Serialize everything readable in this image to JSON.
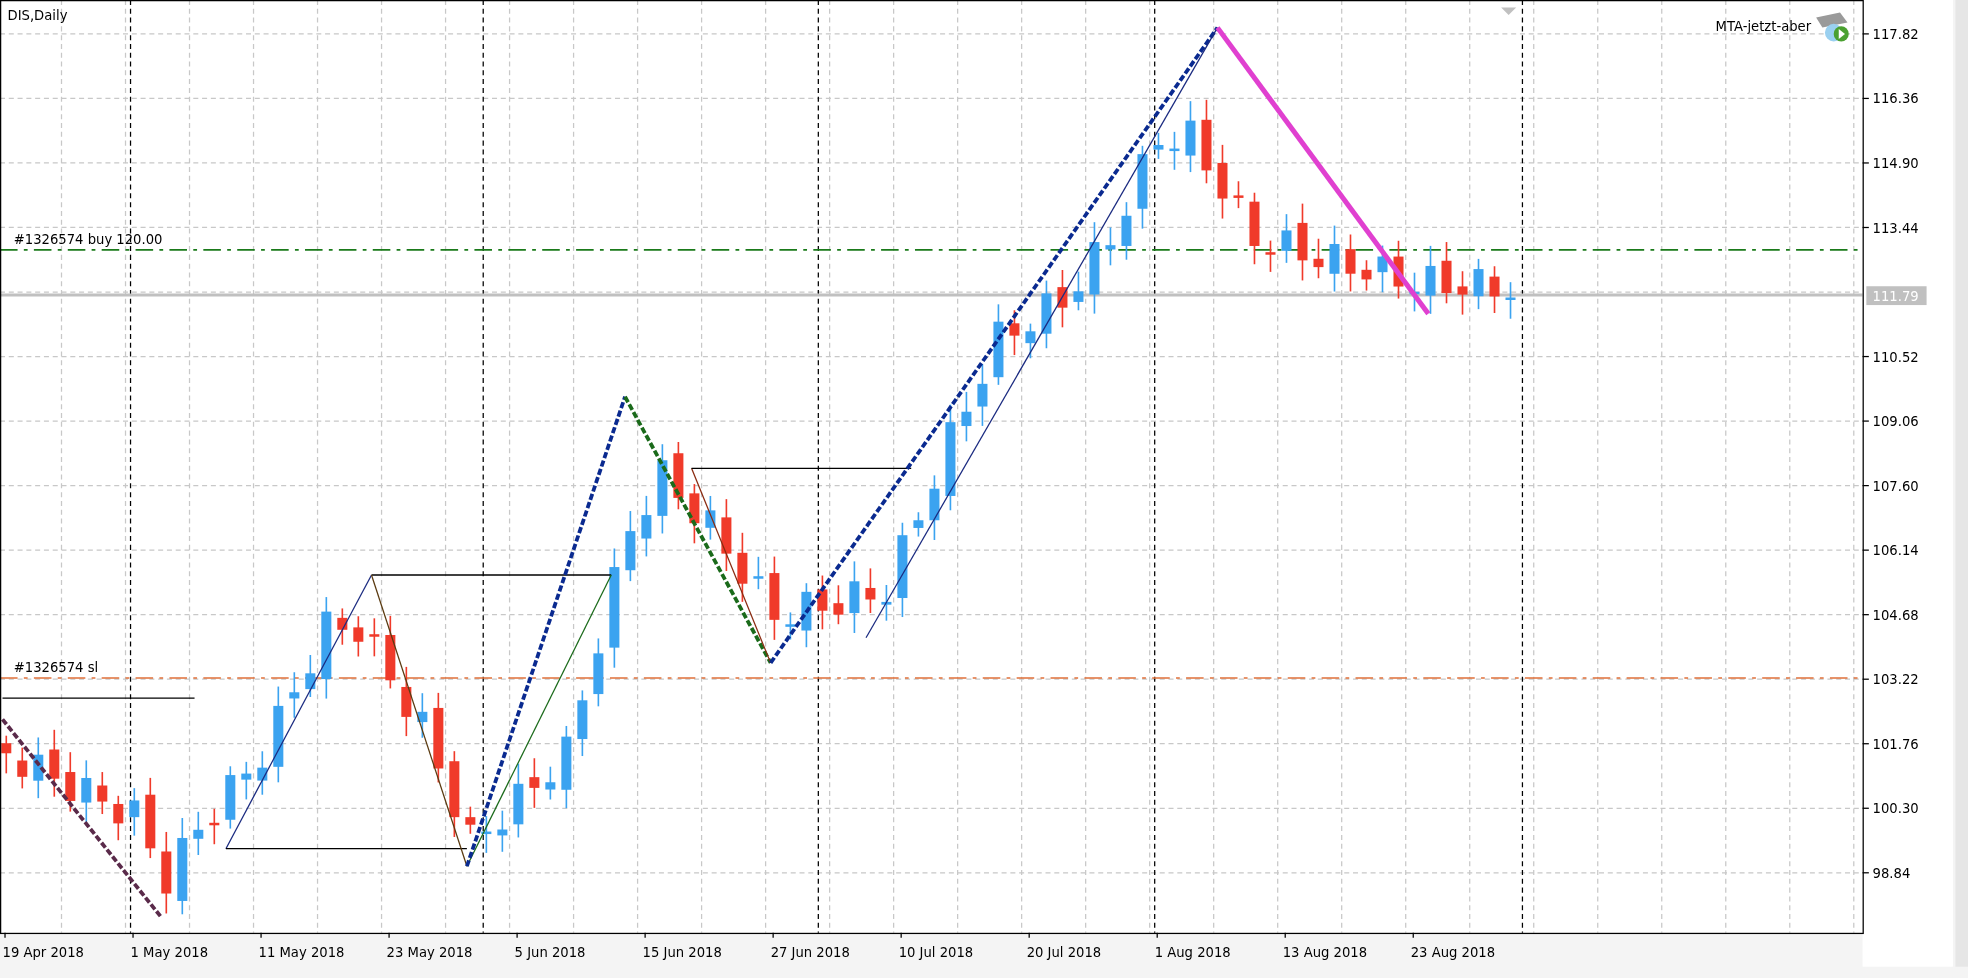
{
  "chart": {
    "title": "DIS,Daily",
    "indicator": "MTA-jetzt-aber",
    "order_lines": [
      {
        "label": "#1326574 buy 120.00",
        "kind": "buy"
      },
      {
        "label": "#1326574 sl",
        "kind": "sl"
      }
    ],
    "current_price": "111.79",
    "price_axis": [
      "117.82",
      "116.36",
      "114.90",
      "113.44",
      "110.52",
      "109.06",
      "107.60",
      "106.14",
      "104.68",
      "103.22",
      "101.76",
      "100.30",
      "98.84"
    ],
    "time_axis": [
      "19 Apr 2018",
      "1 May 2018",
      "11 May 2018",
      "23 May 2018",
      "5 Jun 2018",
      "15 Jun 2018",
      "27 Jun 2018",
      "10 Jul 2018",
      "20 Jul 2018",
      "1 Aug 2018",
      "13 Aug 2018",
      "23 Aug 2018"
    ]
  }
}
